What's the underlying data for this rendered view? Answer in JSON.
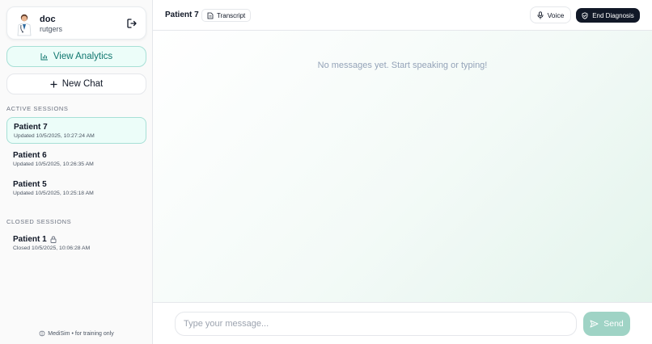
{
  "user": {
    "name": "doc",
    "org": "rutgers"
  },
  "sidebar": {
    "analytics_label": "View Analytics",
    "new_chat_label": "New Chat",
    "active_label": "ACTIVE SESSIONS",
    "closed_label": "CLOSED SESSIONS",
    "active_sessions": [
      {
        "title": "Patient 7",
        "updated": "Updated 10/5/2025, 10:27:24 AM"
      },
      {
        "title": "Patient 6",
        "updated": "Updated 10/5/2025, 10:26:35 AM"
      },
      {
        "title": "Patient 5",
        "updated": "Updated 10/5/2025, 10:25:18 AM"
      }
    ],
    "closed_sessions": [
      {
        "title": "Patient 1",
        "updated": "Closed 10/5/2025, 10:06:28 AM"
      }
    ],
    "footer": "MediSim • for training only"
  },
  "header": {
    "title": "Patient 7",
    "transcript_label": "Transcript",
    "voice_label": "Voice",
    "end_label": "End Diagnosis"
  },
  "chat": {
    "empty_text": "No messages yet. Start speaking or typing!",
    "placeholder": "Type your message...",
    "send_label": "Send"
  },
  "colors": {
    "accent": "#0f766e",
    "accent_bg": "#ecfdf9",
    "send_bg": "#9fd3c5",
    "end_bg": "#111827"
  },
  "icons": {
    "logout": "logout-icon",
    "analytics": "bar-chart-icon",
    "new_chat": "plus-icon",
    "lock": "lock-icon",
    "transcript": "document-icon",
    "voice": "microphone-icon",
    "end": "shield-check-icon",
    "send": "send-icon",
    "footer": "brain-icon"
  }
}
